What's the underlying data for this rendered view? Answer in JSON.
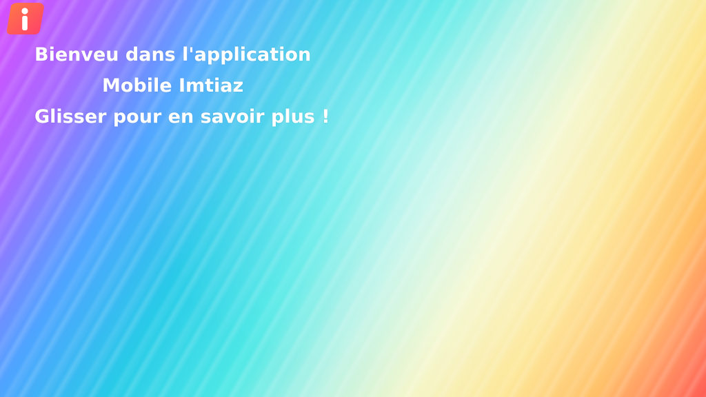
{
  "app": {
    "logo_icon": "info-i-icon",
    "logo_colors": {
      "primary": "#ff5a6a",
      "secondary": "#ff8a2a",
      "glyph": "#ffffff"
    }
  },
  "welcome": {
    "line1": "Bienveu dans l'application",
    "line2": "Mobile Imtiaz",
    "line3": "Glisser pour en savoir plus !"
  }
}
